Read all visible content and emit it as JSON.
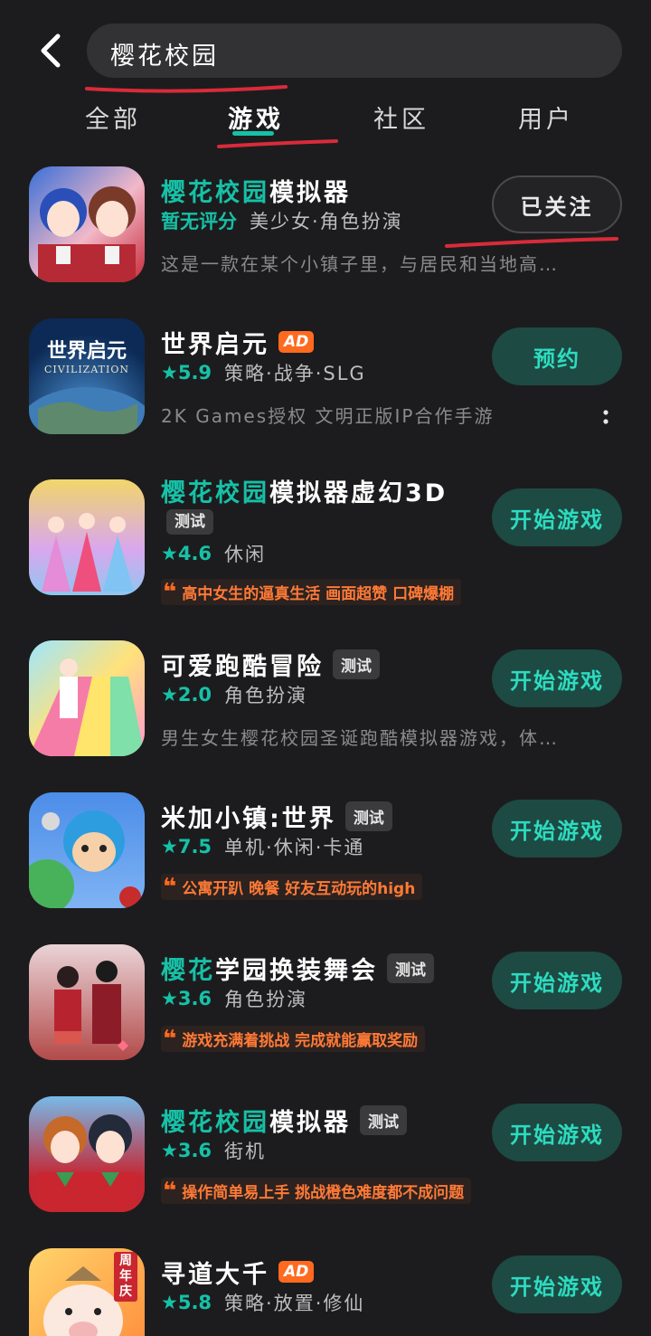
{
  "search": {
    "query": "樱花校园"
  },
  "tabs": [
    {
      "label": "全部"
    },
    {
      "label": "游戏"
    },
    {
      "label": "社区"
    },
    {
      "label": "用户"
    }
  ],
  "accent_color": "#16c1a7",
  "items": [
    {
      "title_hl": "樱花校园",
      "title_rest": "模拟器",
      "rating_label": "暂无评分",
      "tags": "美少女·角色扮演",
      "desc": "这是一款在某个小镇子里，与居民和当地高…",
      "action": "已关注",
      "icon": "anime-girls-icon"
    },
    {
      "title_hl": "",
      "title_rest": "世界启元",
      "badge": "AD",
      "rating": "★5.9",
      "tags": "策略·战争·SLG",
      "desc": "2K Games授权 文明正版IP合作手游",
      "action": "预约",
      "icon": "globe-icon",
      "icon_text_main": "世界启元",
      "icon_text_sub": "CIVILIZATION"
    },
    {
      "title_hl": "樱花校园",
      "title_rest": "模拟器虚幻3D",
      "badge": "测试",
      "rating": "★4.6",
      "tags": "休闲",
      "quote": "高中女生的逼真生活 画面超赞 口碑爆棚",
      "action": "开始游戏",
      "icon": "princess-dresses-icon"
    },
    {
      "title_hl": "",
      "title_rest": "可爱跑酷冒险",
      "badge": "测试",
      "rating": "★2.0",
      "tags": "角色扮演",
      "desc": "男生女生樱花校园圣诞跑酷模拟器游戏，体…",
      "action": "开始游戏",
      "icon": "rainbow-runner-icon"
    },
    {
      "title_hl": "",
      "title_rest": "米加小镇:世界",
      "badge": "测试",
      "rating": "★7.5",
      "tags": "单机·休闲·卡通",
      "quote": "公寓开趴 晚餐 好友互动玩的high",
      "action": "开始游戏",
      "icon": "cartoon-kid-icon"
    },
    {
      "title_hl": "樱花",
      "title_rest": "学园换装舞会",
      "badge": "测试",
      "rating": "★3.6",
      "tags": "角色扮演",
      "quote": "游戏充满着挑战 完成就能赢取奖励",
      "action": "开始游戏",
      "icon": "school-couple-icon"
    },
    {
      "title_hl": "樱花校园",
      "title_rest": "模拟器",
      "badge": "测试",
      "rating": "★3.6",
      "tags": "街机",
      "quote": "操作简单易上手 挑战橙色难度都不成问题",
      "action": "开始游戏",
      "icon": "anime-students-icon"
    },
    {
      "title_hl": "",
      "title_rest": "寻道大千",
      "badge": "AD",
      "rating": "★5.8",
      "tags": "策略·放置·修仙",
      "action": "开始游戏",
      "icon": "pig-character-icon",
      "icon_text_main": "周年庆"
    }
  ]
}
